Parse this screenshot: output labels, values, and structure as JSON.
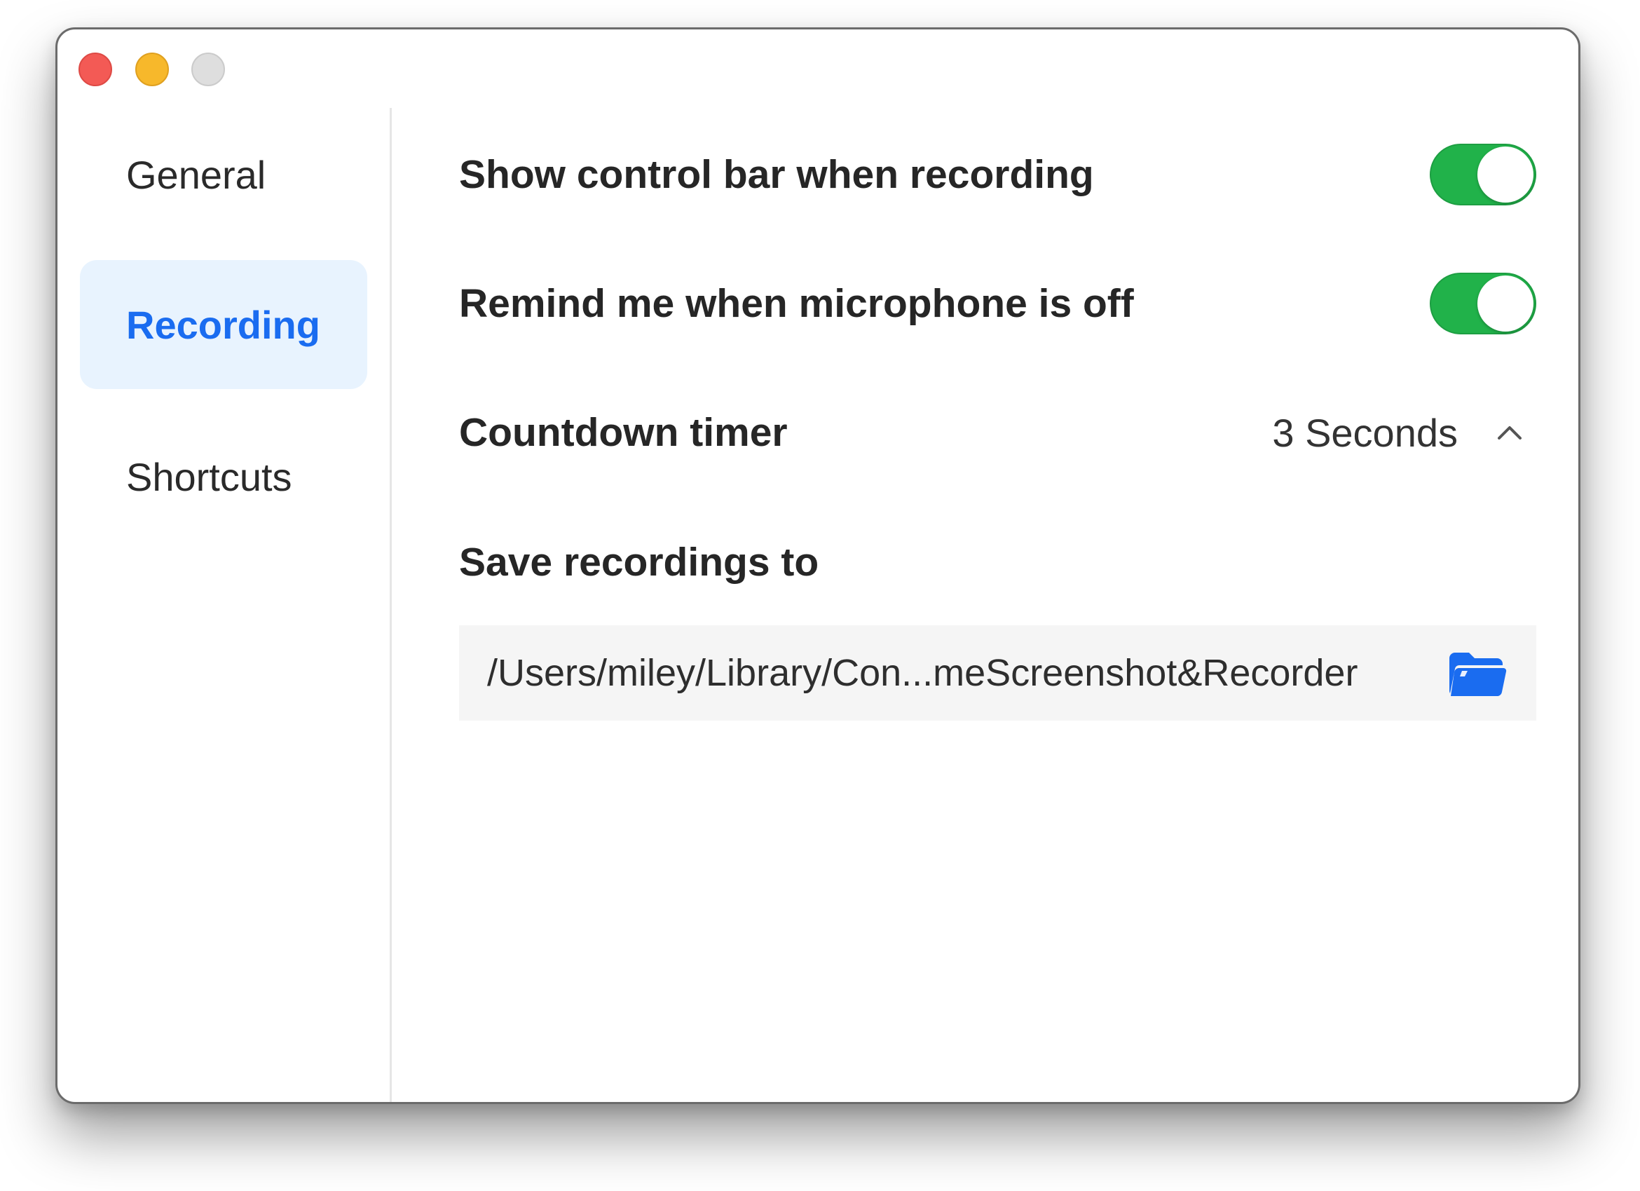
{
  "sidebar": {
    "items": [
      {
        "label": "General",
        "active": false
      },
      {
        "label": "Recording",
        "active": true
      },
      {
        "label": "Shortcuts",
        "active": false
      }
    ]
  },
  "settings": {
    "show_control_bar": {
      "label": "Show control bar when recording",
      "enabled": true
    },
    "remind_microphone": {
      "label": "Remind me when microphone is off",
      "enabled": true
    },
    "countdown": {
      "label": "Countdown timer",
      "value": "3 Seconds"
    },
    "save_to": {
      "label": "Save recordings to",
      "path": "/Users/miley/Library/Con...meScreenshot&Recorder"
    }
  },
  "icons": {
    "countdown_chevron": "chevron-up-icon",
    "folder": "folder-icon"
  },
  "colors": {
    "accent": "#1a6cf0",
    "toggle_on": "#21b24a",
    "sidebar_active_bg": "#e8f3fe",
    "traffic_close": "#f35a55",
    "traffic_minimize": "#f7b82b",
    "traffic_maximize": "#dedede"
  }
}
